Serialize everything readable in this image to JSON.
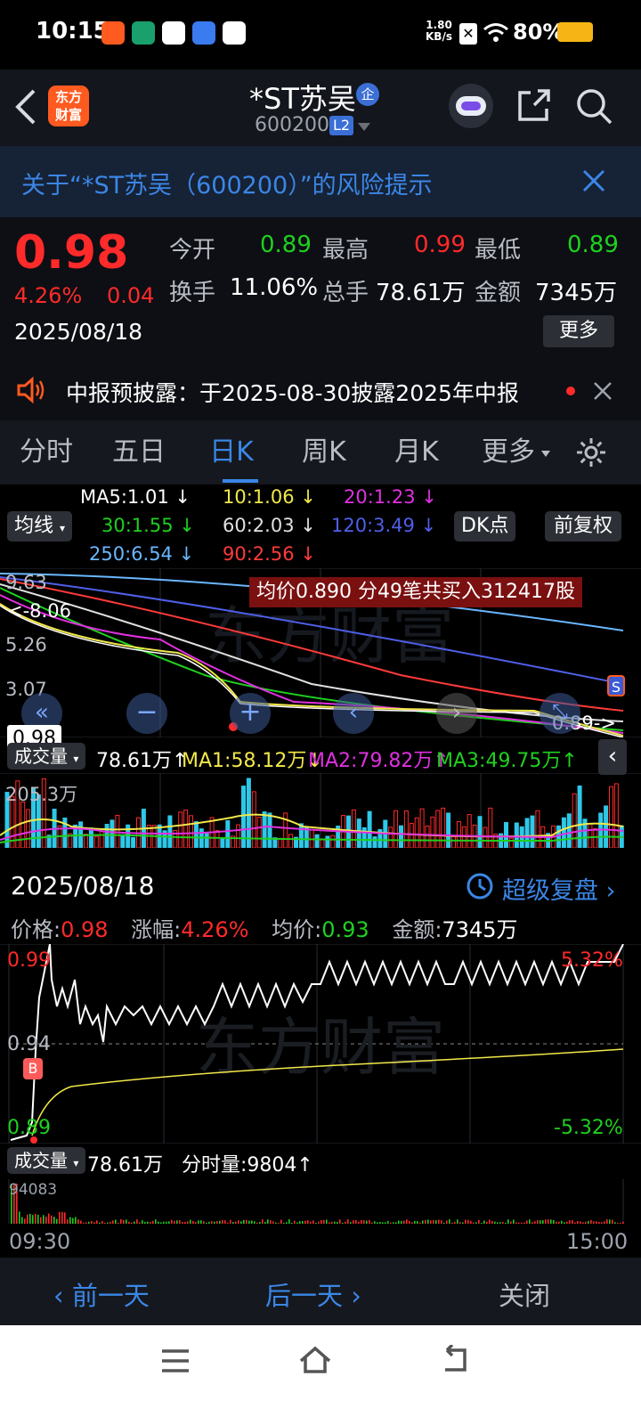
{
  "status": {
    "time": "10:15",
    "net_speed_top": "1.80",
    "net_speed_unit": "KB/s",
    "battery": "80%"
  },
  "header": {
    "logo_line1": "东方",
    "logo_line2": "财富",
    "stock_name": "*ST苏吴",
    "stock_badge": "企",
    "stock_code": "600200",
    "level_badge": "L2"
  },
  "banner": {
    "text": "关于“*ST苏吴（600200）”的风险提示"
  },
  "quote": {
    "price": "0.98",
    "change_pct": "4.26%",
    "change_abs": "0.04",
    "date": "2025/08/18",
    "open_label": "今开",
    "open": "0.89",
    "high_label": "最高",
    "high": "0.99",
    "low_label": "最低",
    "low": "0.89",
    "turnover_label": "换手",
    "turnover": "11.06%",
    "volume_label": "总手",
    "volume": "78.61万",
    "amount_label": "金额",
    "amount": "7345万",
    "more_button": "更多"
  },
  "notice": {
    "text": "中报预披露：于2025-08-30披露2025年中报"
  },
  "tabs": [
    {
      "label": "分时"
    },
    {
      "label": "五日"
    },
    {
      "label": "日K"
    },
    {
      "label": "周K"
    },
    {
      "label": "月K"
    },
    {
      "label": "更多"
    }
  ],
  "colors": {
    "red": "#ff2a2a",
    "green": "#1fd01f",
    "cyan": "#2ec8e8",
    "yellow": "#f2e84a",
    "magenta": "#e030e0",
    "active_tab": "#3b86e6",
    "accent": "#ff5a1f"
  },
  "kline": {
    "ma_labels": {
      "ma5": "MA5:1.01 ↓",
      "ma10": "10:1.06 ↓",
      "ma20": "20:1.23 ↓",
      "ma30": "30:1.55 ↓",
      "ma60": "60:2.03 ↓",
      "ma120": "120:3.49 ↓",
      "ma250": "250:6.54 ↓",
      "ma90": "90:2.56 ↓"
    },
    "ma_button": "均线",
    "dk_button": "DK点",
    "adjust_button": "前复权",
    "axis": {
      "p1": "9.63",
      "p2": "5.26",
      "p3": "3.07"
    },
    "max_marker": "<-8.06",
    "min_marker": "0.89->",
    "current_price_tag": "0.98",
    "s_badge": "S",
    "tooltip": "均价0.890  分49笔共买入312417股",
    "volume_selector": "成交量",
    "volume_total": "78.61万↑",
    "vol_ma1": "MA1:58.12万↓",
    "vol_ma2": "MA2:79.82万↑",
    "vol_ma3": "MA3:49.75万↑",
    "volume_axis_max": "205.3万",
    "watermark": "东方财富"
  },
  "minute": {
    "date": "2025/08/18",
    "replay_link": "超级复盘 ›",
    "price_label": "价格:",
    "price": "0.98",
    "change_label": "涨幅:",
    "change": "4.26%",
    "avg_label": "均价:",
    "avg": "0.93",
    "amount_label": "金额:",
    "amount": "7345万",
    "axis_top": "0.99",
    "axis_mid": "0.94",
    "axis_bottom": "0.89",
    "pct_top": "5.32%",
    "pct_bottom": "-5.32%",
    "b_badge": "B",
    "volume_selector": "成交量",
    "volume_total": "78.61万",
    "minute_volume": "分时量:9804↑",
    "volume_axis_max": "94083",
    "time_start": "09:30",
    "time_end": "15:00",
    "watermark": "东方财富"
  },
  "bottom": {
    "prev": "‹ 前一天",
    "next": "后一天 ›",
    "close": "关闭"
  },
  "icons": [
    "back-arrow-icon",
    "robot-avatar-icon",
    "share-icon",
    "search-icon",
    "close-icon",
    "speaker-icon",
    "settings-gear-icon",
    "history-clock-icon",
    "home-icon",
    "menu-icon",
    "back-nav-icon"
  ]
}
